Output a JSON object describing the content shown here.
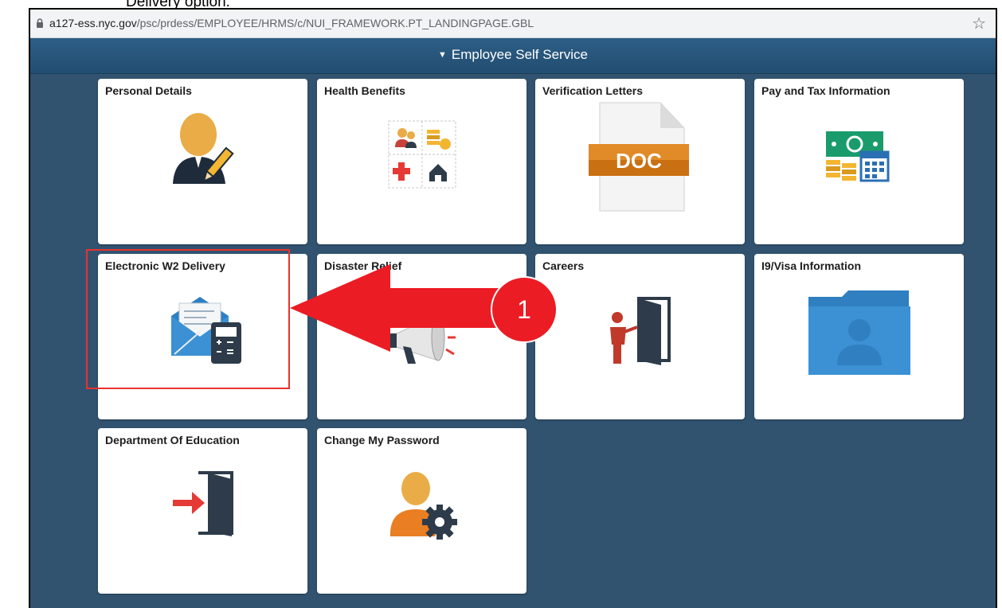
{
  "caption": {
    "text": "Delivery option."
  },
  "browser": {
    "url_host": "a127-ess.nyc.gov",
    "url_path": "/psc/prdess/EMPLOYEE/HRMS/c/NUI_FRAMEWORK.PT_LANDINGPAGE.GBL"
  },
  "header": {
    "title": "Employee Self Service"
  },
  "tiles": [
    {
      "label": "Personal Details",
      "icon": "person-edit-icon"
    },
    {
      "label": "Health Benefits",
      "icon": "health-benefits-icon"
    },
    {
      "label": "Verification Letters",
      "icon": "doc-file-icon",
      "icon_text": "DOC"
    },
    {
      "label": "Pay and Tax Information",
      "icon": "pay-calendar-icon"
    },
    {
      "label": "Electronic W2 Delivery",
      "icon": "envelope-calculator-icon"
    },
    {
      "label": "Disaster Relief",
      "icon": "megaphone-icon"
    },
    {
      "label": "Careers",
      "icon": "person-door-icon"
    },
    {
      "label": "I9/Visa Information",
      "icon": "folder-person-icon"
    },
    {
      "label": "Department Of Education",
      "icon": "door-enter-icon"
    },
    {
      "label": "Change My Password",
      "icon": "person-gear-icon"
    }
  ],
  "annotation": {
    "step": "1",
    "color": "#ec1c24"
  },
  "colors": {
    "background": "#31536f",
    "banner": "#2d5e86",
    "tile": "#ffffff"
  }
}
